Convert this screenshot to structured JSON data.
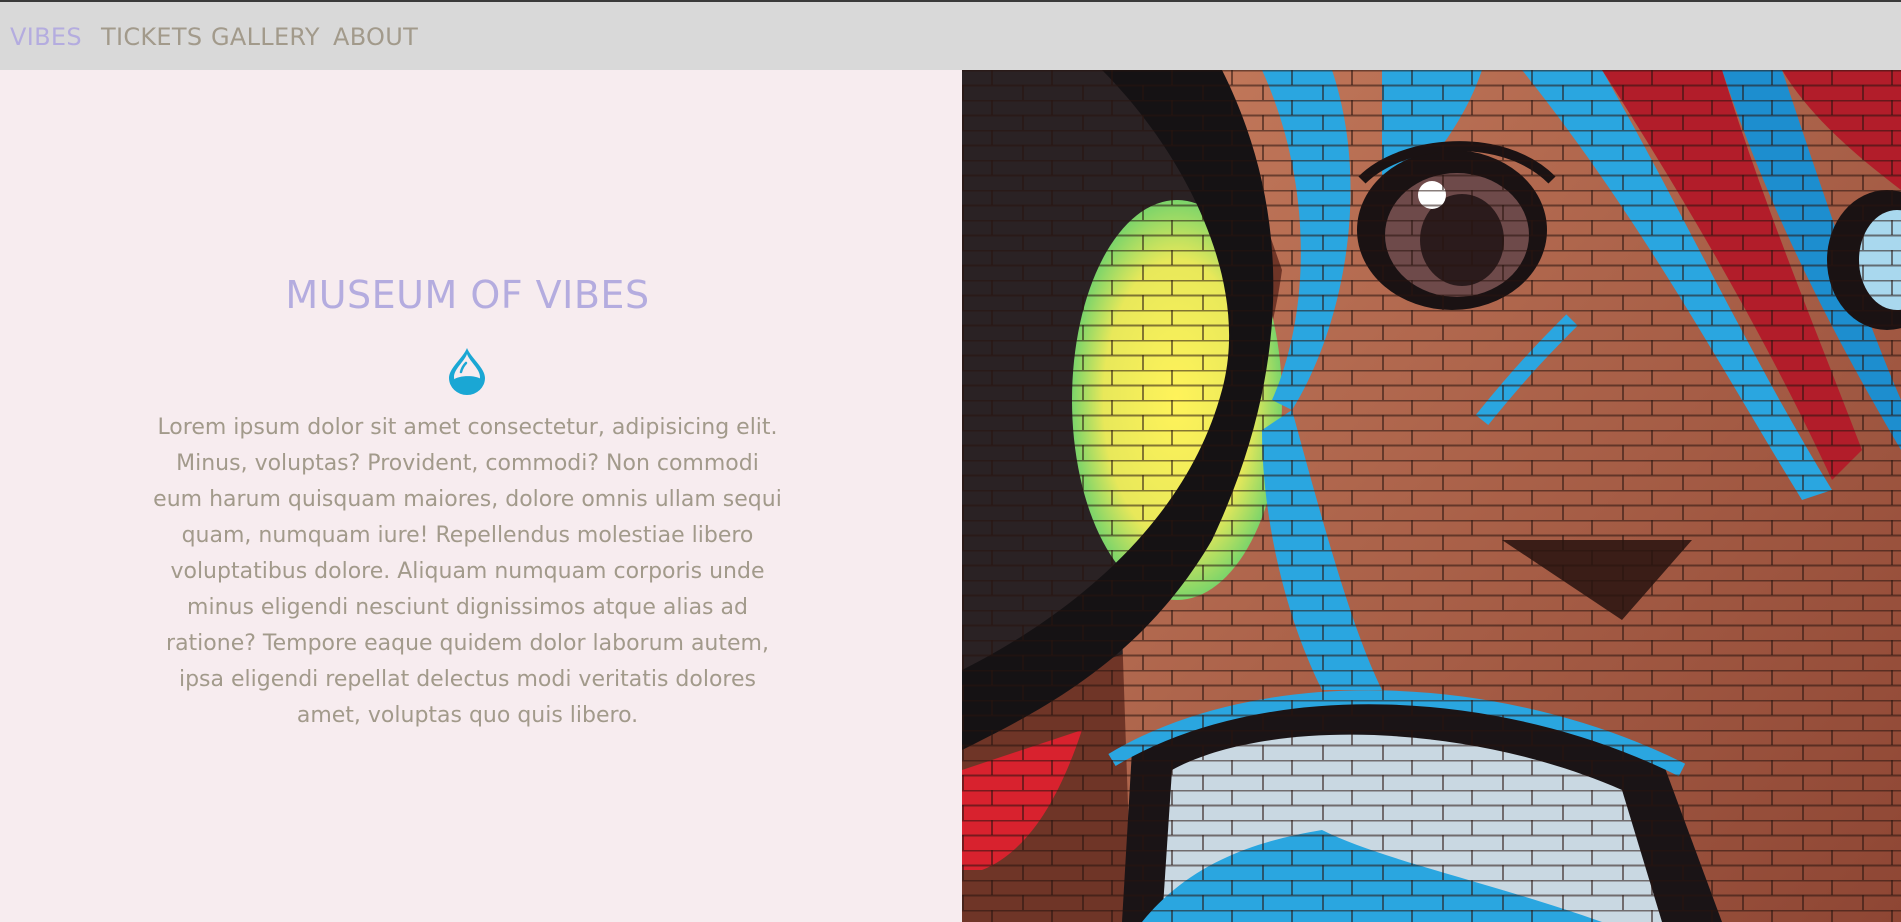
{
  "nav": {
    "brand": "VIBES",
    "links": [
      "TICKETS",
      "GALLERY",
      "ABOUT"
    ]
  },
  "hero": {
    "title": "MUSEUM OF VIBES",
    "icon": "water-drop-icon",
    "body": "Lorem ipsum dolor sit amet consectetur, adipisicing elit. Minus, voluptas? Provident, commodi? Non commodi eum harum quisquam maiores, dolore omnis ullam sequi quam, numquam iure! Repellendus molestiae libero voluptatibus dolore. Aliquam numquam corporis unde minus eligendi nesciunt dignissimos atque alias ad ratione? Tempore eaque quidem dolor laborum autem, ipsa eligendi repellat delectus modi veritatis dolores amet, voluptas quo quis libero."
  },
  "colors": {
    "accent": "#b4acdf",
    "text": "#a29a8b",
    "nav_background": "#d9d9d9",
    "page_background": "#f7ecef",
    "icon": "#1aa7d4"
  }
}
